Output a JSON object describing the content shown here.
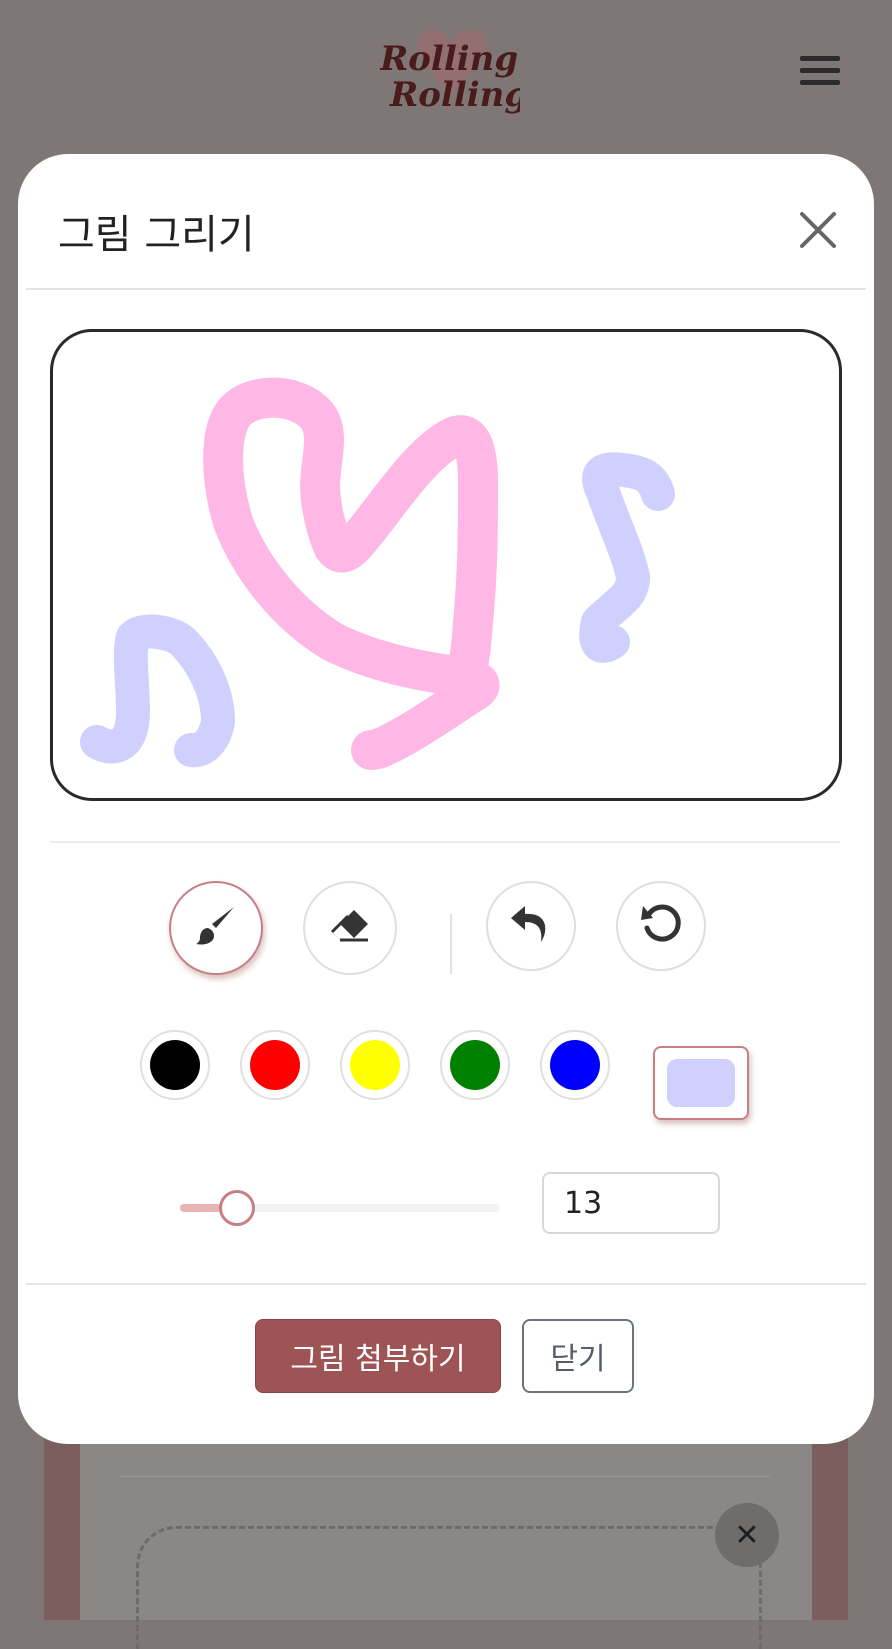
{
  "header": {
    "logo_text_line1": "Rolling",
    "logo_text_line2": "Rolling"
  },
  "modal": {
    "title": "그림 그리기",
    "tools": {
      "brush_icon": "paintbrush-icon",
      "eraser_icon": "eraser-icon",
      "undo_icon": "undo-icon",
      "reset_icon": "rotate-icon"
    },
    "colors": [
      "#000000",
      "#ff0000",
      "#ffff00",
      "#008000",
      "#0000ff"
    ],
    "custom_color": "#d0d0ff",
    "brush_size": {
      "min": 1,
      "max": 100,
      "value": "13"
    },
    "attach_label": "그림 첨부하기",
    "close_label": "닫기"
  },
  "canvas_strokes": {
    "heart_color": "#ffb8e6",
    "note_color": "#d0d0ff"
  },
  "accent_color": "#9e5455"
}
